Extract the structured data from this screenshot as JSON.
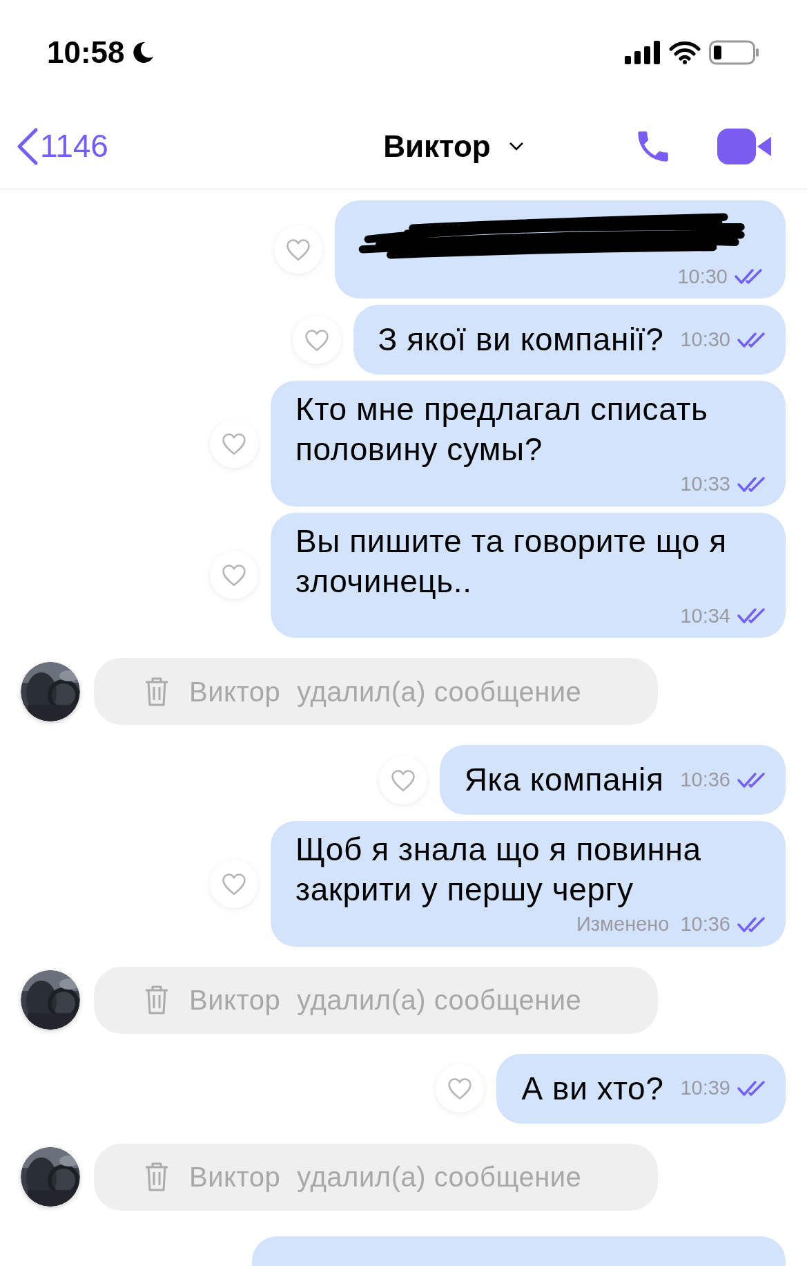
{
  "status_bar": {
    "time": "10:58"
  },
  "header": {
    "back_label": "1146",
    "title": "Виктор"
  },
  "messages": [
    {
      "kind": "redacted",
      "time": "10:30",
      "read": true
    },
    {
      "kind": "short",
      "text": "З якої ви компанії?",
      "time": "10:30",
      "read": true
    },
    {
      "kind": "long",
      "text": "Кто мне предлагал списать половину сумы?",
      "time": "10:33",
      "read": true
    },
    {
      "kind": "long",
      "text": "Вы пишите та говорите що я злочинець..",
      "time": "10:34",
      "read": true
    },
    {
      "kind": "deleted",
      "sender": "Виктор",
      "text": "удалил(а) сообщение"
    },
    {
      "kind": "short",
      "text": "Яка компанія",
      "time": "10:36",
      "read": true
    },
    {
      "kind": "long",
      "text": "Щоб я знала що я повинна закрити у першу чергу",
      "edited_label": "Изменено",
      "time": "10:36",
      "read": true
    },
    {
      "kind": "deleted",
      "sender": "Виктор",
      "text": "удалил(а) сообщение"
    },
    {
      "kind": "short",
      "text": "А ви хто?",
      "time": "10:39",
      "read": true
    },
    {
      "kind": "deleted",
      "sender": "Виктор",
      "text": "удалил(а) сообщение"
    },
    {
      "kind": "cut_off"
    }
  ]
}
